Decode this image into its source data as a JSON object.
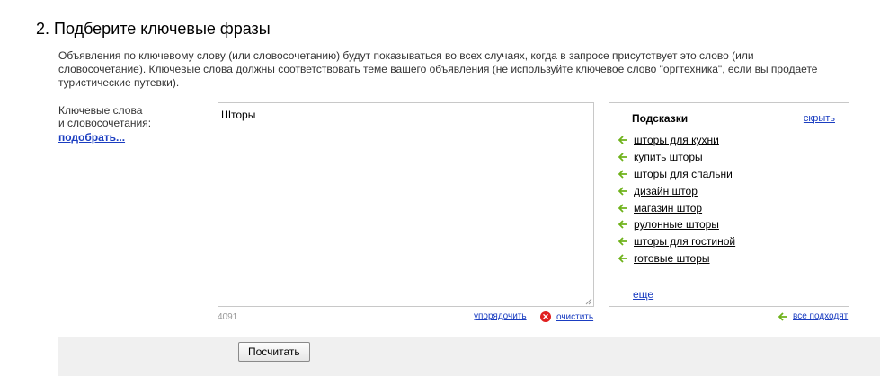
{
  "section": {
    "title": "2. Подберите ключевые фразы",
    "description": "Объявления по ключевому слову (или словосочетанию) будут показываться во всех случаях, когда в запросе присутствует это слово (или словосочетание). Ключевые слова должны соответствовать теме вашего объявления (не используйте ключевое слово \"оргтехника\", если вы продаете туристические путевки)."
  },
  "keywords": {
    "label_line1": "Ключевые слова",
    "label_line2": "и словосочетания:",
    "pick_link": "подобрать...",
    "value": "Шторы",
    "counter": "4091",
    "sort_link": "упорядочить",
    "clear_link": "очистить"
  },
  "hints": {
    "title": "Подсказки",
    "hide_link": "скрыть",
    "items": [
      "шторы для кухни",
      "купить шторы",
      "шторы для спальни",
      "дизайн штор",
      "магазин штор",
      "рулонные шторы",
      "шторы для гостиной",
      "готовые шторы"
    ],
    "more_link": "еще",
    "all_fit_link": "все подходят"
  },
  "actions": {
    "calculate_button": "Посчитать"
  },
  "icons": {
    "hint_arrow": "arrow-left-icon",
    "clear": "clear-icon",
    "arrow_color": "#6fb21b",
    "clear_color": "#e02020"
  }
}
